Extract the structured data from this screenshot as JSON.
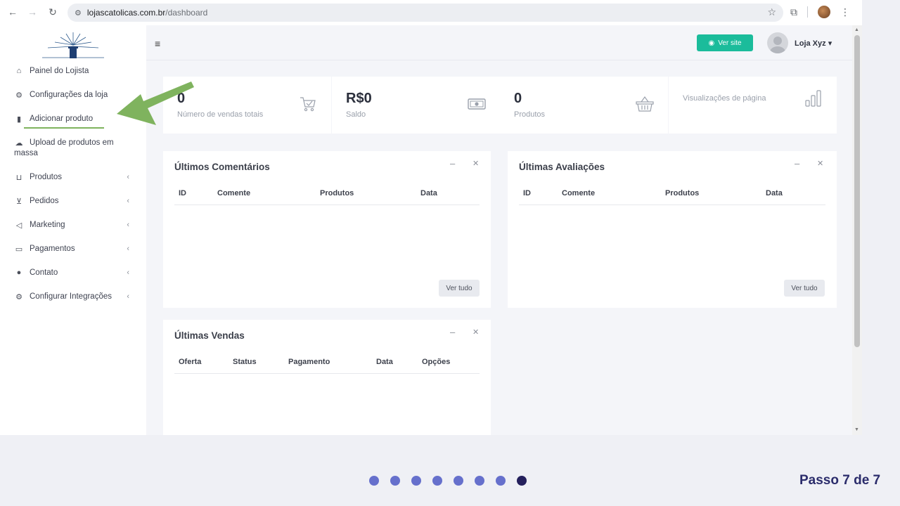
{
  "browser": {
    "url_domain": "lojascatolicas.com.br",
    "url_path": "/dashboard"
  },
  "sidebar": {
    "items": [
      {
        "label": "Painel do Lojista",
        "icon": "home-icon"
      },
      {
        "label": "Configurações da loja",
        "icon": "gear-icon"
      },
      {
        "label": "Adicionar produto",
        "icon": "file-icon"
      },
      {
        "label": "Upload de produtos em",
        "label2": "massa",
        "icon": "cloud-upload-icon"
      },
      {
        "label": "Produtos",
        "icon": "basket-icon",
        "chevron": "‹"
      },
      {
        "label": "Pedidos",
        "icon": "cart-icon",
        "chevron": "‹"
      },
      {
        "label": "Marketing",
        "icon": "megaphone-icon",
        "chevron": "‹"
      },
      {
        "label": "Pagamentos",
        "icon": "credit-card-icon",
        "chevron": "‹"
      },
      {
        "label": "Contato",
        "icon": "chat-icon",
        "chevron": "‹"
      },
      {
        "label": "Configurar Integrações",
        "icon": "gear-icon",
        "chevron": "‹"
      }
    ]
  },
  "topbar": {
    "ver_site": "Ver site",
    "user_name": "Loja Xyz"
  },
  "stats": [
    {
      "value": "0",
      "label": "Número de vendas totais",
      "icon": "cart-check-icon"
    },
    {
      "value": "R$0",
      "label": "Saldo",
      "icon": "money-icon"
    },
    {
      "value": "0",
      "label": "Produtos",
      "icon": "basket-icon"
    },
    {
      "value": "",
      "label": "Visualizações de página",
      "icon": "bar-chart-icon"
    }
  ],
  "panels": {
    "comentarios": {
      "title": "Últimos Comentários",
      "columns": [
        "ID",
        "Comente",
        "Produtos",
        "Data"
      ],
      "button": "Ver tudo"
    },
    "avaliacoes": {
      "title": "Últimas Avaliações",
      "columns": [
        "ID",
        "Comente",
        "Produtos",
        "Data"
      ],
      "button": "Ver tudo"
    },
    "vendas": {
      "title": "Últimas Vendas",
      "columns": [
        "Oferta",
        "Status",
        "Pagamento",
        "Data",
        "Opções"
      ]
    }
  },
  "panel_controls": {
    "minimize": "–",
    "close": "✕"
  },
  "pager": {
    "total": 8,
    "active": 7,
    "step_text": "Passo 7 de 7"
  },
  "colors": {
    "accent": "#1bbc9b",
    "arrow": "#7fb35e",
    "dot": "#6670cc",
    "dot_active": "#24205c"
  }
}
